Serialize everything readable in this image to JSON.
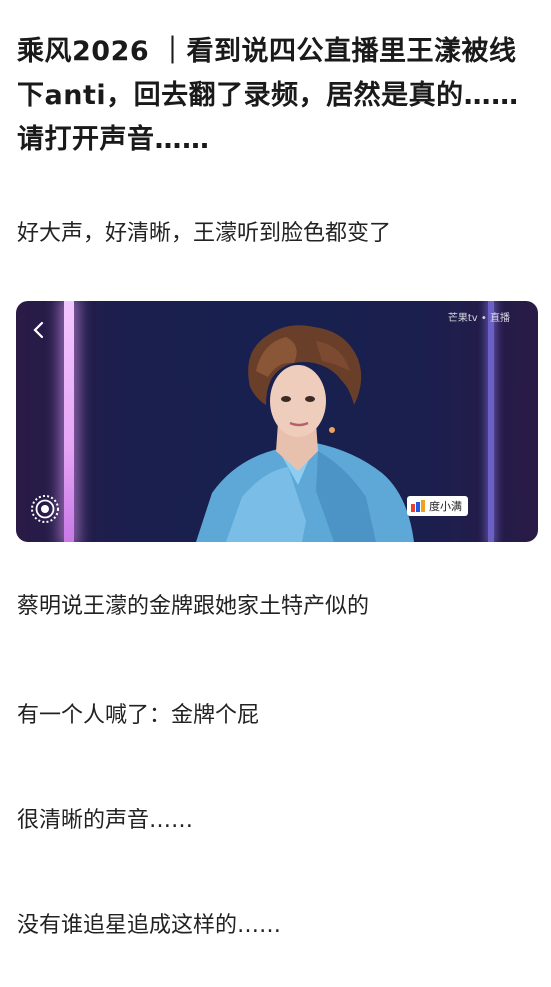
{
  "article": {
    "title": "乘风2026 ｜看到说四公直播里王漾被线下anti，回去翻了录频，居然是真的……请打开声音……",
    "paragraphs": [
      "好大声，好清晰，王濛听到脸色都变了",
      "蔡明说王濛的金牌跟她家土特产似的",
      "有一个人喊了：金牌个屁",
      "很清晰的声音……",
      "没有谁追星追成这样的……"
    ]
  },
  "video": {
    "back_icon": "chevron-left-icon",
    "watermark": "芒果tv • 直播",
    "sponsor_label": "度小满",
    "live_icon": "broadcast-icon"
  }
}
